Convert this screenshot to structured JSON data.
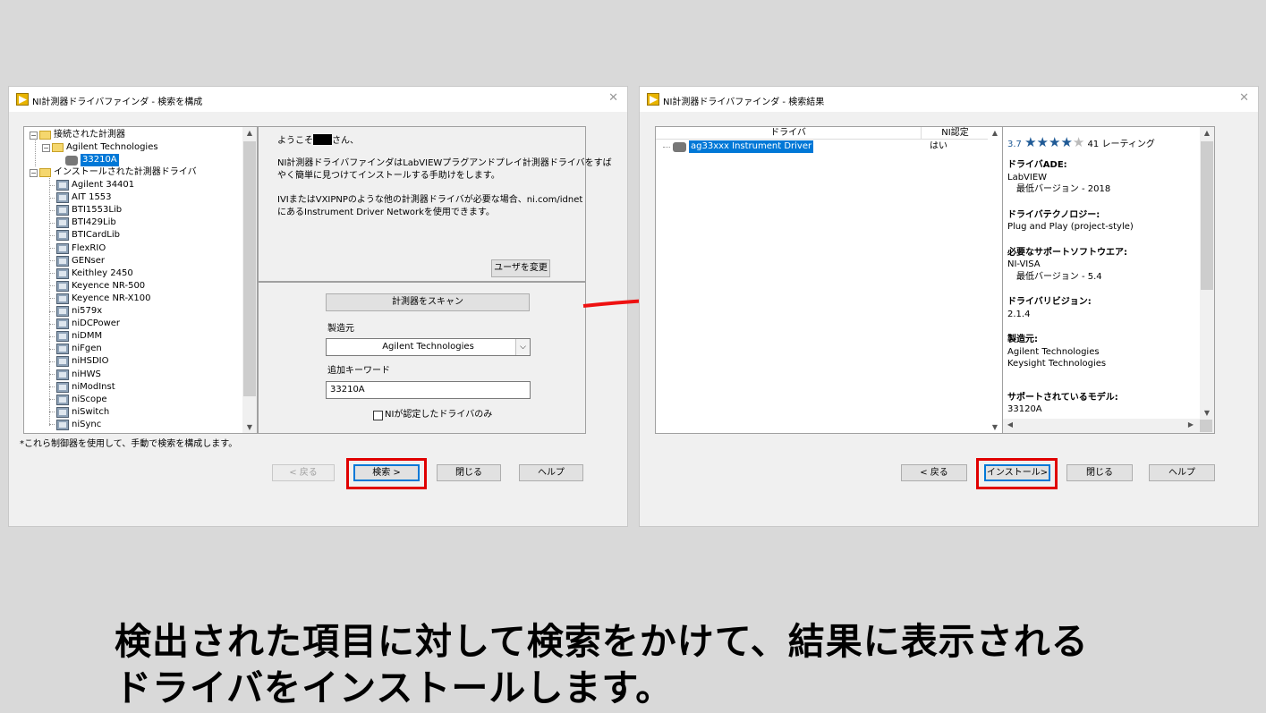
{
  "left_window": {
    "title": "NI計測器ドライバファインダ - 検索を構成",
    "tree": {
      "connected_root": "接続された計測器",
      "vendor": "Agilent Technologies",
      "device": "33210A",
      "installed_root": "インストールされた計測器ドライバ",
      "drivers": [
        "Agilent 34401",
        "AIT 1553",
        "BTI1553Lib",
        "BTI429Lib",
        "BTICardLib",
        "FlexRIO",
        "GENser",
        "Keithley 2450",
        "Keyence NR-500",
        "Keyence NR-X100",
        "ni579x",
        "niDCPower",
        "niDMM",
        "niFgen",
        "niHSDIO",
        "niHWS",
        "niModInst",
        "niScope",
        "niSwitch",
        "niSync"
      ]
    },
    "welcome_prefix": "ようこそ",
    "welcome_suffix": "さん、",
    "intro_line1": "NI計測器ドライバファインダはLabVIEWプラグアンドプレイ計測器ドライバをすば",
    "intro_line2": "やく簡単に見つけてインストールする手助けをします。",
    "ivi_line1": "IVIまたはVXIPNPのような他の計測器ドライバが必要な場合、ni.com/idnet",
    "ivi_line2": "にあるInstrument Driver Networkを使用できます。",
    "change_user": "ユーザを変更",
    "scan_button": "計測器をスキャン",
    "manufacturer_label": "製造元",
    "manufacturer_value": "Agilent Technologies",
    "keyword_label": "追加キーワード",
    "keyword_value": "33210A",
    "ni_certified_only": "NIが認定したドライバのみ",
    "footnote": "*これら制御器を使用して、手動で検索を構成します。",
    "back": "< 戻る",
    "search": "検索 >",
    "close": "閉じる",
    "help": "ヘルプ"
  },
  "right_window": {
    "title": "NI計測器ドライバファインダ - 検索結果",
    "col_driver": "ドライバ",
    "col_ni": "NI認定",
    "result_name": "ag33xxx Instrument Driver",
    "result_ni": "はい",
    "rating_value": "3.7",
    "rating_stars": 4,
    "rating_count": "41 レーティング",
    "details": [
      {
        "label": "ドライバADE:",
        "lines": [
          "LabVIEW",
          "　最低バージョン - 2018"
        ]
      },
      {
        "label": "ドライバテクノロジー:",
        "lines": [
          "Plug and Play (project-style)"
        ]
      },
      {
        "label": "必要なサポートソフトウエア:",
        "lines": [
          "NI-VISA",
          "　最低バージョン - 5.4"
        ]
      },
      {
        "label": "ドライバリビジョン:",
        "lines": [
          "2.1.4"
        ]
      },
      {
        "label": "製造元:",
        "lines": [
          "Agilent Technologies",
          "Keysight Technologies"
        ]
      },
      {
        "label": "サポートされているモデル:",
        "lines": [
          "33120A"
        ]
      }
    ],
    "back": "< 戻る",
    "install": "インストール>",
    "close": "閉じる",
    "help": "ヘルプ"
  },
  "caption": {
    "line1": "検出された項目に対して検索をかけて、結果に表示される",
    "line2": "ドライバをインストールします。"
  },
  "colors": {
    "highlight": "#e00000",
    "arrow": "#ee1111",
    "selection": "#0078d7",
    "star": "#1f5a96"
  }
}
